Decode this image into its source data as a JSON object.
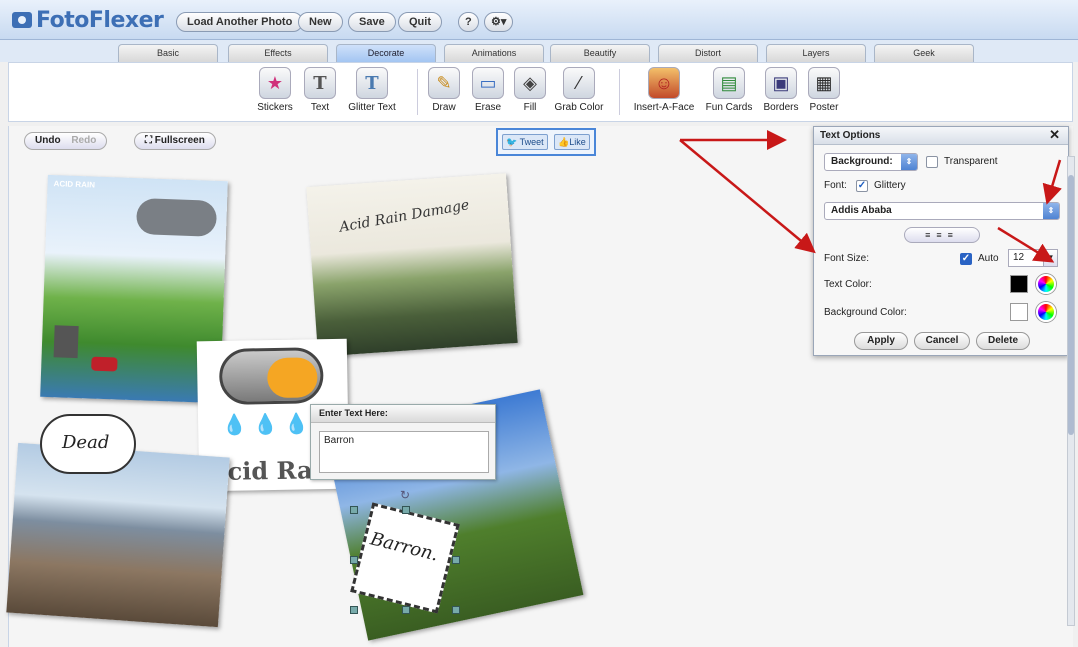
{
  "app": {
    "name": "FotoFlexer"
  },
  "header": {
    "buttons": [
      "Load Another Photo",
      "New",
      "Save",
      "Quit"
    ],
    "help_label": "?",
    "settings_label": "⚙▾"
  },
  "tabs": [
    "Basic",
    "Effects",
    "Decorate",
    "Animations",
    "Beautify",
    "Distort",
    "Layers",
    "Geek"
  ],
  "active_tab": "Decorate",
  "tools": [
    {
      "label": "Stickers",
      "icon": "stickers-icon",
      "glyph": "★"
    },
    {
      "label": "Text",
      "icon": "text-icon",
      "glyph": "T"
    },
    {
      "label": "Glitter Text",
      "icon": "glitter-text-icon",
      "glyph": "T"
    },
    {
      "label": "Draw",
      "icon": "pencil-icon",
      "glyph": "✎"
    },
    {
      "label": "Erase",
      "icon": "eraser-icon",
      "glyph": "▭"
    },
    {
      "label": "Fill",
      "icon": "paint-bucket-icon",
      "glyph": "◈"
    },
    {
      "label": "Grab Color",
      "icon": "eyedropper-icon",
      "glyph": "⁄"
    },
    {
      "label": "Insert-A-Face",
      "icon": "face-icon",
      "glyph": "☺"
    },
    {
      "label": "Fun Cards",
      "icon": "fun-cards-icon",
      "glyph": "▤"
    },
    {
      "label": "Borders",
      "icon": "borders-icon",
      "glyph": "▣"
    },
    {
      "label": "Poster",
      "icon": "poster-icon",
      "glyph": "▦"
    }
  ],
  "canvas_controls": {
    "undo": "Undo",
    "redo": "Redo",
    "fullscreen": "Fullscreen"
  },
  "social": {
    "tweet": "Tweet",
    "like": "Like"
  },
  "photos": {
    "acid_rain_diagram_title": "ACID RAIN",
    "damage_caption": "Acid Rain Damage",
    "cloud_caption": "Acid Ra",
    "dead_caption": "Dead",
    "text_layer": "Barron."
  },
  "text_dialog": {
    "title": "Enter Text Here:",
    "value": "Barron"
  },
  "text_options": {
    "title": "Text Options",
    "background_select": "Background:",
    "transparent_label": "Transparent",
    "font_label": "Font:",
    "glittery_label": "Glittery",
    "font_value": "Addis Ababa",
    "font_size_label": "Font Size:",
    "auto_label": "Auto",
    "font_size_value": "12",
    "text_color_label": "Text Color:",
    "bg_color_label": "Background Color:",
    "apply": "Apply",
    "cancel": "Cancel",
    "delete": "Delete",
    "text_color": "#000000",
    "bg_color": "#ffffff"
  }
}
